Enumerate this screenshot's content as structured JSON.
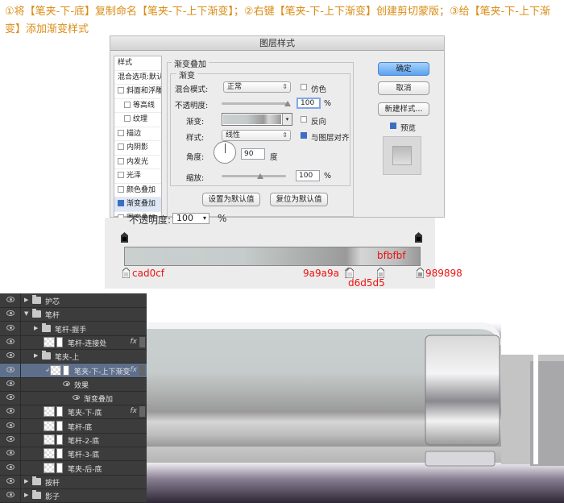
{
  "instruction": "①将【笔夹-下-底】复制命名【笔夹-下-上下渐变】；②右键【笔夹-下-上下渐变】创建剪切蒙版；③给【笔夹-下-上下渐变】添加渐变样式",
  "dialog": {
    "title": "图层样式",
    "style_list": {
      "header": "样式",
      "blend_default": "混合选项:默认",
      "items": [
        {
          "label": "斜面和浮雕",
          "checked": false,
          "indent": false
        },
        {
          "label": "等高线",
          "checked": false,
          "indent": true
        },
        {
          "label": "纹理",
          "checked": false,
          "indent": true
        },
        {
          "label": "描边",
          "checked": false,
          "indent": false
        },
        {
          "label": "内阴影",
          "checked": false,
          "indent": false
        },
        {
          "label": "内发光",
          "checked": false,
          "indent": false
        },
        {
          "label": "光泽",
          "checked": false,
          "indent": false
        },
        {
          "label": "颜色叠加",
          "checked": false,
          "indent": false
        },
        {
          "label": "渐变叠加",
          "checked": true,
          "indent": false,
          "selected": true
        },
        {
          "label": "图案叠加",
          "checked": false,
          "indent": false
        }
      ]
    },
    "gradient_overlay": {
      "group_title": "渐变叠加",
      "sub_title": "渐变",
      "blend_mode_label": "混合模式:",
      "blend_mode_value": "正常",
      "dither_label": "仿色",
      "opacity_label": "不透明度:",
      "opacity_value": "100",
      "percent": "%",
      "gradient_label": "渐变:",
      "reverse_label": "反向",
      "style_label": "样式:",
      "style_value": "线性",
      "align_label": "与图层对齐",
      "angle_label": "角度:",
      "angle_value": "90",
      "degree": "度",
      "scale_label": "缩放:",
      "scale_value": "100",
      "set_default": "设置为默认值",
      "reset_default": "复位为默认值"
    },
    "buttons": {
      "ok": "确定",
      "cancel": "取消",
      "new_style": "新建样式...",
      "preview": "预览"
    }
  },
  "gradient_editor": {
    "opacity_label": "不透明度:",
    "opacity_value": "100",
    "stops": [
      {
        "color": "#cad0cf",
        "label": "cad0cf"
      },
      {
        "color": "#9a9a9a",
        "label": "9a9a9a"
      },
      {
        "color": "#d6d5d5",
        "label": "d6d5d5"
      },
      {
        "color": "#bfbfbf",
        "label": "bfbfbf"
      },
      {
        "color": "#989898",
        "label": "989898"
      }
    ]
  },
  "layers": [
    {
      "name": "护芯",
      "type": "folder",
      "open": false,
      "indent": 0
    },
    {
      "name": "笔杆",
      "type": "folder",
      "open": true,
      "indent": 0
    },
    {
      "name": "笔杆-握手",
      "type": "folder",
      "open": false,
      "indent": 1
    },
    {
      "name": "笔杆-连接处",
      "type": "layer",
      "fx": true,
      "indent": 1
    },
    {
      "name": "笔夹-上",
      "type": "folder",
      "open": false,
      "indent": 1
    },
    {
      "name": "笔夹-下-上下渐变",
      "type": "layer",
      "fx": true,
      "indent": 1,
      "selected": true,
      "clipped": true
    },
    {
      "name": "效果",
      "type": "effect",
      "indent": 2
    },
    {
      "name": "渐变叠加",
      "type": "effect",
      "indent": 3
    },
    {
      "name": "笔夹-下-底",
      "type": "layer",
      "fx": true,
      "indent": 1
    },
    {
      "name": "笔杆-底",
      "type": "layer",
      "indent": 1
    },
    {
      "name": "笔杆-2-底",
      "type": "layer",
      "indent": 1
    },
    {
      "name": "笔杆-3-底",
      "type": "layer",
      "indent": 1
    },
    {
      "name": "笔夹-后-底",
      "type": "layer",
      "indent": 1
    },
    {
      "name": "按杆",
      "type": "folder",
      "open": false,
      "indent": 0
    },
    {
      "name": "影子",
      "type": "folder",
      "open": false,
      "indent": 0
    }
  ],
  "fx_symbol": "fx"
}
